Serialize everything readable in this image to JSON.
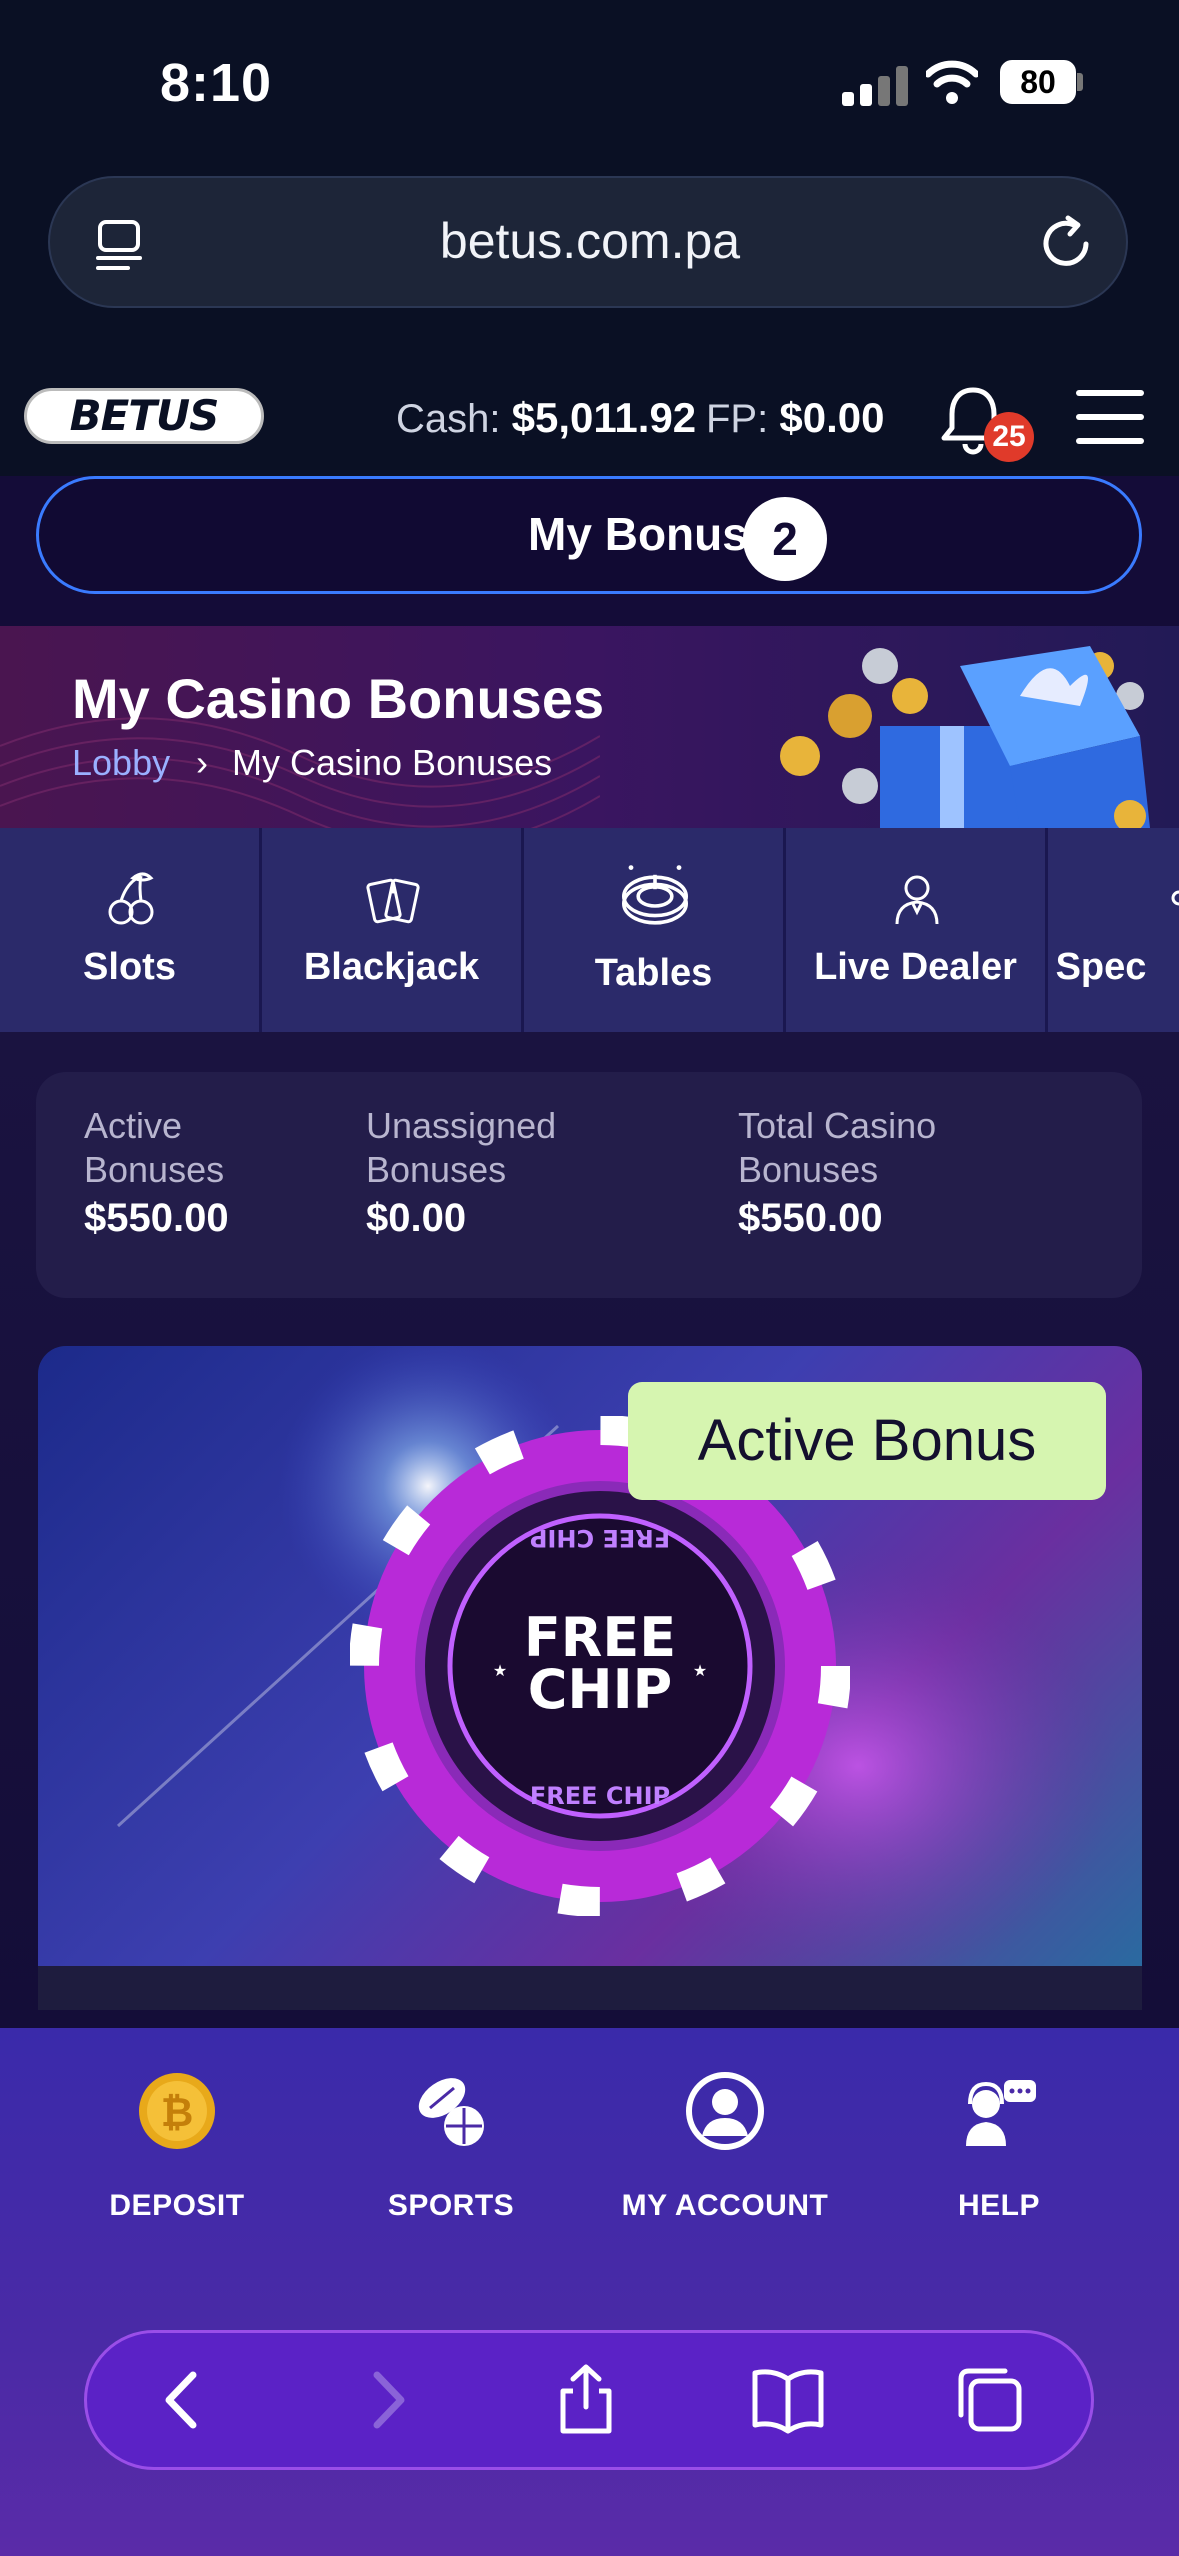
{
  "status_bar": {
    "time": "8:10",
    "battery": "80"
  },
  "browser": {
    "url": "betus.com.pa"
  },
  "header": {
    "logo": "BETUS",
    "cash_label": "Cash:",
    "cash_value": "$5,011.92",
    "fp_label": "FP:",
    "fp_value": "$0.00",
    "notification_count": "25"
  },
  "my_bonuses": {
    "label": "My Bonuses",
    "count": "2"
  },
  "banner": {
    "title": "My Casino Bonuses",
    "breadcrumb": [
      "Lobby",
      "My Casino Bonuses"
    ]
  },
  "tabs": [
    {
      "label": "Slots",
      "icon": "cherries-icon"
    },
    {
      "label": "Blackjack",
      "icon": "cards-icon"
    },
    {
      "label": "Tables",
      "icon": "roulette-icon"
    },
    {
      "label": "Live Dealer",
      "icon": "dealer-icon"
    },
    {
      "label": "Spec",
      "icon": "specialty-icon"
    }
  ],
  "stats": {
    "active": {
      "label_1": "Active",
      "label_2": "Bonuses",
      "value": "$550.00"
    },
    "unassigned": {
      "label_1": "Unassigned",
      "label_2": "Bonuses",
      "value": "$0.00"
    },
    "total": {
      "label_1": "Total Casino",
      "label_2": "Bonuses",
      "value": "$550.00"
    }
  },
  "card": {
    "badge": "Active Bonus",
    "chip_text_1": "FREE",
    "chip_text_2": "CHIP",
    "ring_text": "FREE CHIP"
  },
  "bottom_nav": [
    {
      "label": "DEPOSIT",
      "icon": "bitcoin-icon"
    },
    {
      "label": "SPORTS",
      "icon": "sports-balls-icon"
    },
    {
      "label": "MY ACCOUNT",
      "icon": "account-icon"
    },
    {
      "label": "HELP",
      "icon": "support-agent-icon"
    }
  ],
  "colors": {
    "background": "#0a1024",
    "accent_blue": "#3a7bff",
    "badge_green": "#d6f5b0",
    "notification_red": "#e03a2a",
    "nav_purple": "#4a2aa6"
  }
}
